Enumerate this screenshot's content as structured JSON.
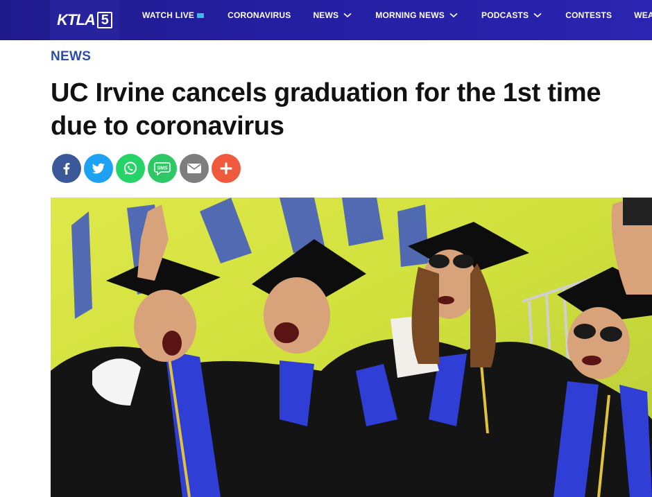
{
  "header": {
    "logo_text": "KTLA",
    "logo_number": "5",
    "nav": [
      {
        "label": "WATCH LIVE",
        "has_tv_icon": true,
        "has_dropdown": false
      },
      {
        "label": "CORONAVIRUS",
        "has_dropdown": false
      },
      {
        "label": "NEWS",
        "has_dropdown": true
      },
      {
        "label": "MORNING NEWS",
        "has_dropdown": true
      },
      {
        "label": "PODCASTS",
        "has_dropdown": true
      },
      {
        "label": "CONTESTS",
        "has_dropdown": false
      },
      {
        "label": "WEATHER",
        "has_dropdown": false
      }
    ]
  },
  "article": {
    "section": "NEWS",
    "headline": "UC Irvine cancels graduation for the 1st time due to coronavirus"
  },
  "share": {
    "buttons": [
      {
        "icon": "facebook-icon",
        "color": "#3b5998"
      },
      {
        "icon": "twitter-icon",
        "color": "#1da1f2"
      },
      {
        "icon": "whatsapp-icon",
        "color": "#25d366"
      },
      {
        "icon": "sms-icon",
        "color": "#2ec866",
        "label": "SMS"
      },
      {
        "icon": "email-icon",
        "color": "#7d7d7d"
      },
      {
        "icon": "plus-icon",
        "color": "#f05a3c"
      }
    ]
  },
  "colors": {
    "nav_background": "#2a24b0",
    "section_label": "#2b4da8",
    "headline": "#111111"
  }
}
